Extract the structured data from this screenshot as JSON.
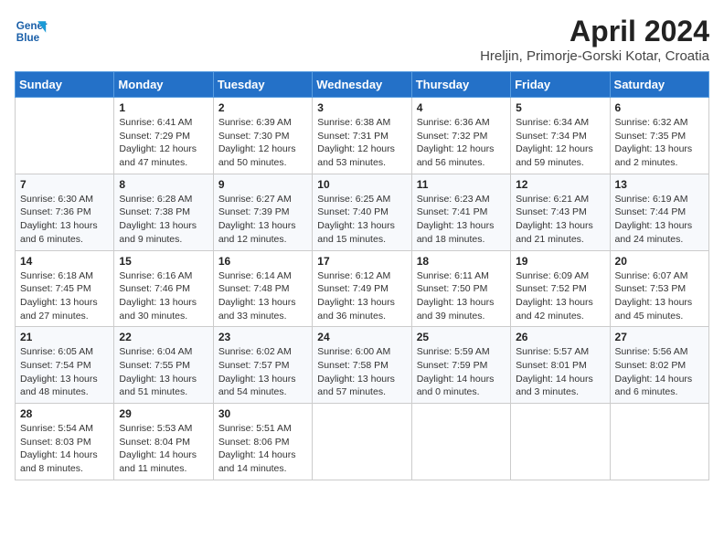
{
  "header": {
    "logo_line1": "General",
    "logo_line2": "Blue",
    "title": "April 2024",
    "subtitle": "Hreljin, Primorje-Gorski Kotar, Croatia"
  },
  "columns": [
    "Sunday",
    "Monday",
    "Tuesday",
    "Wednesday",
    "Thursday",
    "Friday",
    "Saturday"
  ],
  "weeks": [
    [
      {
        "day": "",
        "info": ""
      },
      {
        "day": "1",
        "info": "Sunrise: 6:41 AM\nSunset: 7:29 PM\nDaylight: 12 hours\nand 47 minutes."
      },
      {
        "day": "2",
        "info": "Sunrise: 6:39 AM\nSunset: 7:30 PM\nDaylight: 12 hours\nand 50 minutes."
      },
      {
        "day": "3",
        "info": "Sunrise: 6:38 AM\nSunset: 7:31 PM\nDaylight: 12 hours\nand 53 minutes."
      },
      {
        "day": "4",
        "info": "Sunrise: 6:36 AM\nSunset: 7:32 PM\nDaylight: 12 hours\nand 56 minutes."
      },
      {
        "day": "5",
        "info": "Sunrise: 6:34 AM\nSunset: 7:34 PM\nDaylight: 12 hours\nand 59 minutes."
      },
      {
        "day": "6",
        "info": "Sunrise: 6:32 AM\nSunset: 7:35 PM\nDaylight: 13 hours\nand 2 minutes."
      }
    ],
    [
      {
        "day": "7",
        "info": "Sunrise: 6:30 AM\nSunset: 7:36 PM\nDaylight: 13 hours\nand 6 minutes."
      },
      {
        "day": "8",
        "info": "Sunrise: 6:28 AM\nSunset: 7:38 PM\nDaylight: 13 hours\nand 9 minutes."
      },
      {
        "day": "9",
        "info": "Sunrise: 6:27 AM\nSunset: 7:39 PM\nDaylight: 13 hours\nand 12 minutes."
      },
      {
        "day": "10",
        "info": "Sunrise: 6:25 AM\nSunset: 7:40 PM\nDaylight: 13 hours\nand 15 minutes."
      },
      {
        "day": "11",
        "info": "Sunrise: 6:23 AM\nSunset: 7:41 PM\nDaylight: 13 hours\nand 18 minutes."
      },
      {
        "day": "12",
        "info": "Sunrise: 6:21 AM\nSunset: 7:43 PM\nDaylight: 13 hours\nand 21 minutes."
      },
      {
        "day": "13",
        "info": "Sunrise: 6:19 AM\nSunset: 7:44 PM\nDaylight: 13 hours\nand 24 minutes."
      }
    ],
    [
      {
        "day": "14",
        "info": "Sunrise: 6:18 AM\nSunset: 7:45 PM\nDaylight: 13 hours\nand 27 minutes."
      },
      {
        "day": "15",
        "info": "Sunrise: 6:16 AM\nSunset: 7:46 PM\nDaylight: 13 hours\nand 30 minutes."
      },
      {
        "day": "16",
        "info": "Sunrise: 6:14 AM\nSunset: 7:48 PM\nDaylight: 13 hours\nand 33 minutes."
      },
      {
        "day": "17",
        "info": "Sunrise: 6:12 AM\nSunset: 7:49 PM\nDaylight: 13 hours\nand 36 minutes."
      },
      {
        "day": "18",
        "info": "Sunrise: 6:11 AM\nSunset: 7:50 PM\nDaylight: 13 hours\nand 39 minutes."
      },
      {
        "day": "19",
        "info": "Sunrise: 6:09 AM\nSunset: 7:52 PM\nDaylight: 13 hours\nand 42 minutes."
      },
      {
        "day": "20",
        "info": "Sunrise: 6:07 AM\nSunset: 7:53 PM\nDaylight: 13 hours\nand 45 minutes."
      }
    ],
    [
      {
        "day": "21",
        "info": "Sunrise: 6:05 AM\nSunset: 7:54 PM\nDaylight: 13 hours\nand 48 minutes."
      },
      {
        "day": "22",
        "info": "Sunrise: 6:04 AM\nSunset: 7:55 PM\nDaylight: 13 hours\nand 51 minutes."
      },
      {
        "day": "23",
        "info": "Sunrise: 6:02 AM\nSunset: 7:57 PM\nDaylight: 13 hours\nand 54 minutes."
      },
      {
        "day": "24",
        "info": "Sunrise: 6:00 AM\nSunset: 7:58 PM\nDaylight: 13 hours\nand 57 minutes."
      },
      {
        "day": "25",
        "info": "Sunrise: 5:59 AM\nSunset: 7:59 PM\nDaylight: 14 hours\nand 0 minutes."
      },
      {
        "day": "26",
        "info": "Sunrise: 5:57 AM\nSunset: 8:01 PM\nDaylight: 14 hours\nand 3 minutes."
      },
      {
        "day": "27",
        "info": "Sunrise: 5:56 AM\nSunset: 8:02 PM\nDaylight: 14 hours\nand 6 minutes."
      }
    ],
    [
      {
        "day": "28",
        "info": "Sunrise: 5:54 AM\nSunset: 8:03 PM\nDaylight: 14 hours\nand 8 minutes."
      },
      {
        "day": "29",
        "info": "Sunrise: 5:53 AM\nSunset: 8:04 PM\nDaylight: 14 hours\nand 11 minutes."
      },
      {
        "day": "30",
        "info": "Sunrise: 5:51 AM\nSunset: 8:06 PM\nDaylight: 14 hours\nand 14 minutes."
      },
      {
        "day": "",
        "info": ""
      },
      {
        "day": "",
        "info": ""
      },
      {
        "day": "",
        "info": ""
      },
      {
        "day": "",
        "info": ""
      }
    ]
  ]
}
